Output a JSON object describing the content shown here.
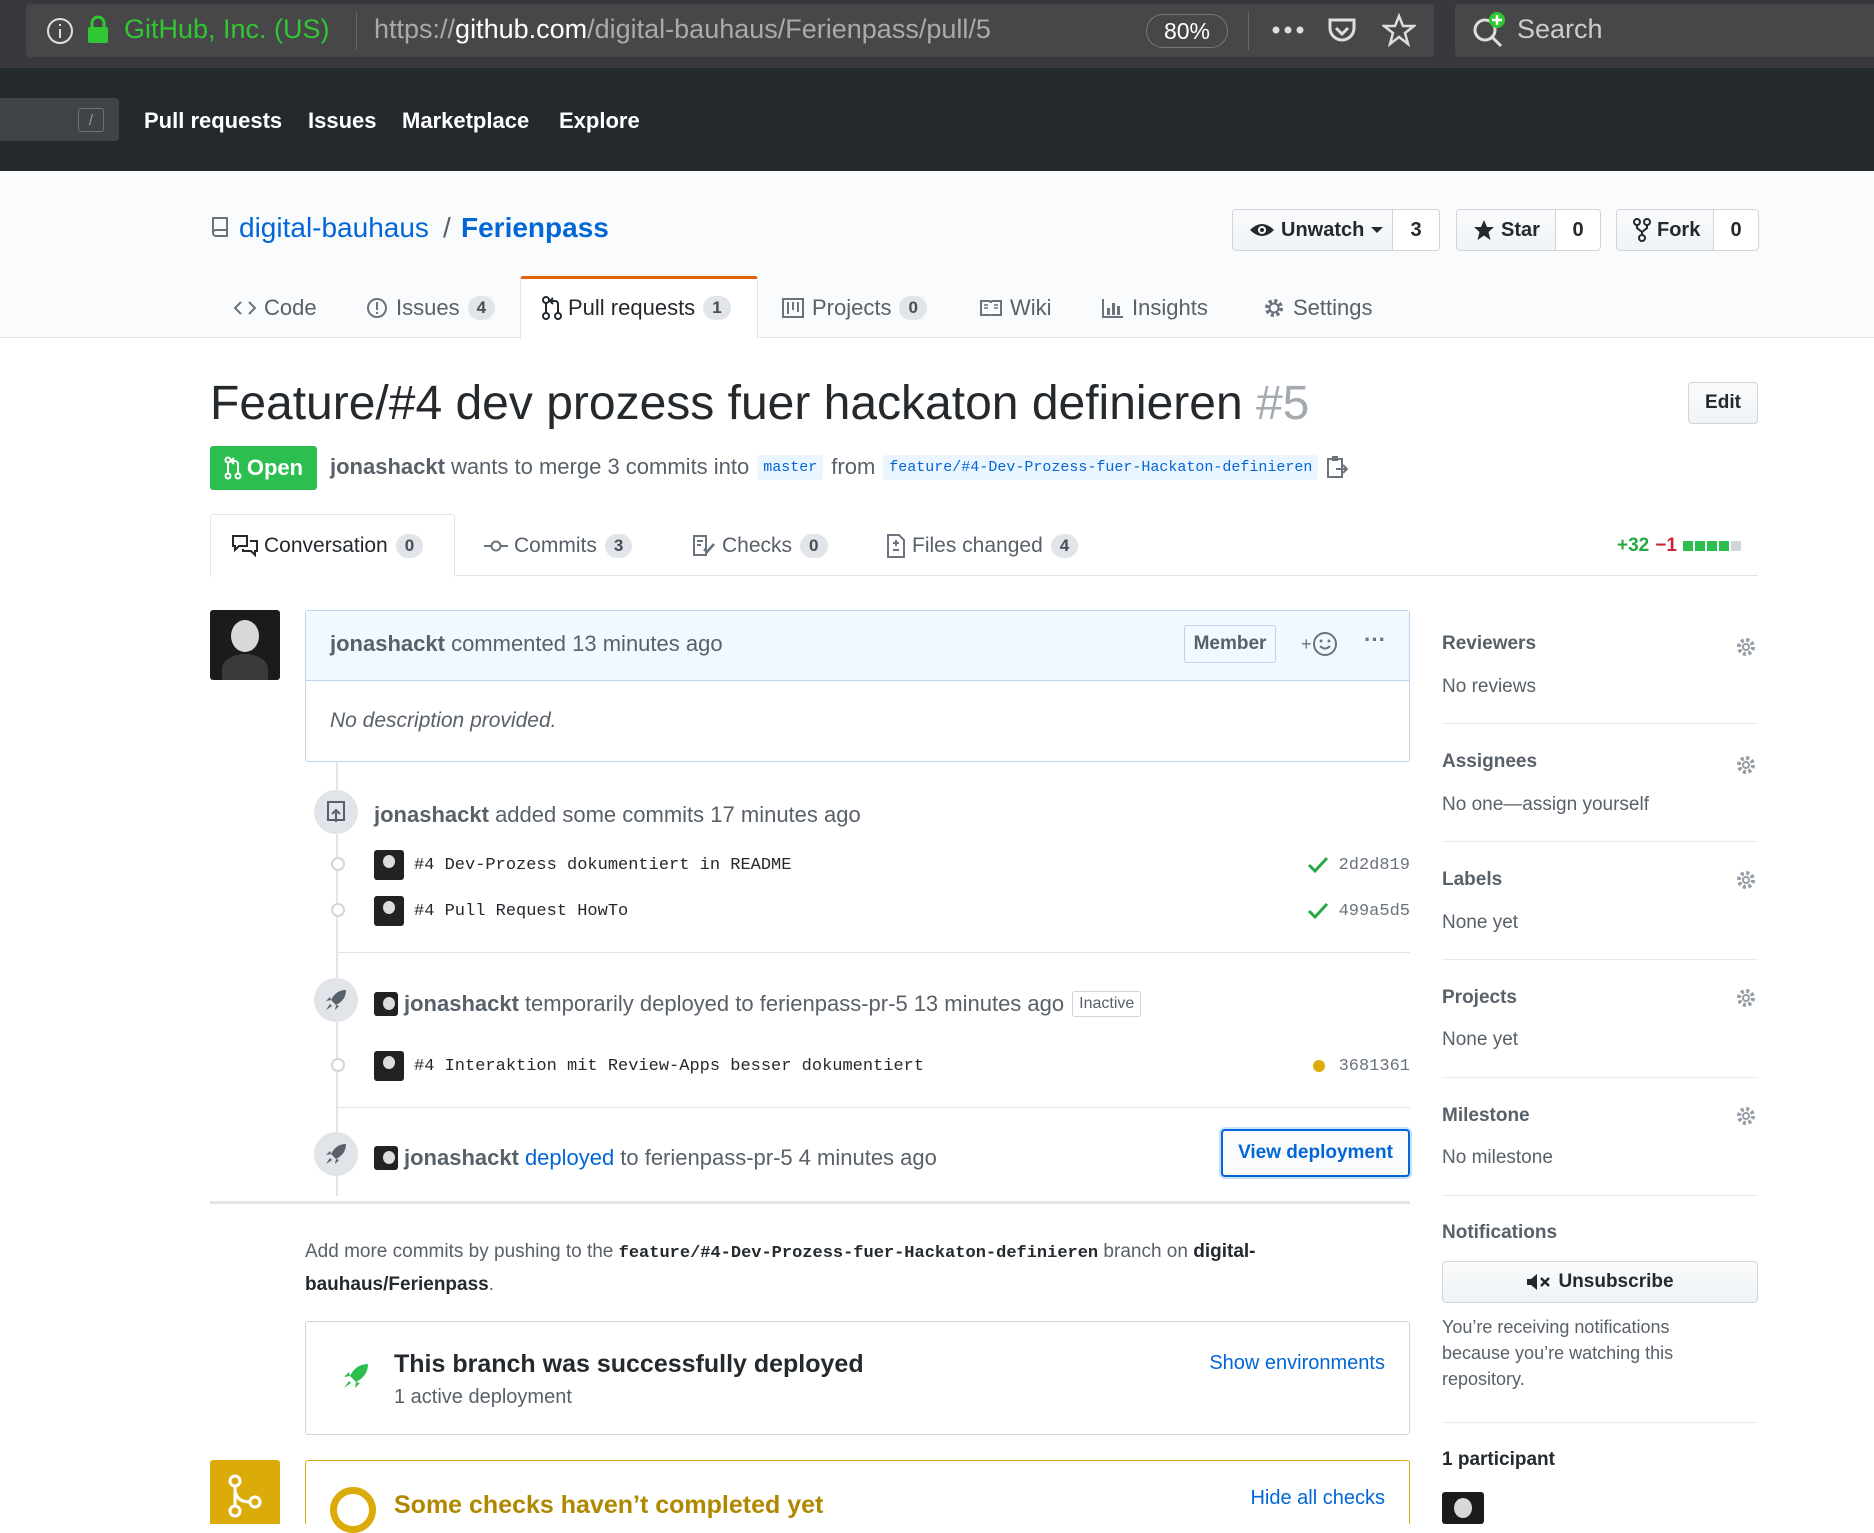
{
  "browser": {
    "identity": "GitHub, Inc. (US)",
    "url_prefix": "https://",
    "url_domain": "github.com",
    "url_path": "/digital-bauhaus/Ferienpass/pull/5",
    "zoom": "80%",
    "search_placeholder": "Search"
  },
  "header": {
    "slash": "/",
    "nav": [
      "Pull requests",
      "Issues",
      "Marketplace",
      "Explore"
    ]
  },
  "repo": {
    "owner": "digital-bauhaus",
    "sep": "/",
    "name": "Ferienpass",
    "unwatch_label": "Unwatch",
    "watch_count": "3",
    "star_label": "Star",
    "star_count": "0",
    "fork_label": "Fork",
    "fork_count": "0",
    "tabs": [
      {
        "label": "Code",
        "count": ""
      },
      {
        "label": "Issues",
        "count": "4"
      },
      {
        "label": "Pull requests",
        "count": "1"
      },
      {
        "label": "Projects",
        "count": "0"
      },
      {
        "label": "Wiki",
        "count": ""
      },
      {
        "label": "Insights",
        "count": ""
      },
      {
        "label": "Settings",
        "count": ""
      }
    ]
  },
  "pr": {
    "title": "Feature/#4 dev prozess fuer hackaton definieren",
    "number": "#5",
    "edit_label": "Edit",
    "state": "Open",
    "author": "jonashackt",
    "merge_text": "wants to merge 3 commits into",
    "base": "master",
    "from_text": "from",
    "head": "feature/#4-Dev-Prozess-fuer-Hackaton-definieren",
    "tabs": [
      {
        "label": "Conversation",
        "count": "0"
      },
      {
        "label": "Commits",
        "count": "3"
      },
      {
        "label": "Checks",
        "count": "0"
      },
      {
        "label": "Files changed",
        "count": "4"
      }
    ],
    "additions": "+32",
    "deletions": "−1"
  },
  "comment": {
    "author": "jonashackt",
    "action": "commented",
    "time": "13 minutes ago",
    "role": "Member",
    "reaction": "+",
    "more": "···",
    "body": "No description provided."
  },
  "timeline": {
    "commits_event": {
      "author": "jonashackt",
      "text": "added some commits",
      "time": "17 minutes ago"
    },
    "commits": [
      {
        "message": "#4 Dev-Prozess dokumentiert in README",
        "sha": "2d2d819",
        "status": "success"
      },
      {
        "message": "#4 Pull Request HowTo",
        "sha": "499a5d5",
        "status": "success"
      }
    ],
    "deploy1": {
      "author": "jonashackt",
      "text": "temporarily deployed to ferienpass-pr-5",
      "time": "13 minutes ago",
      "state": "Inactive"
    },
    "commit3": {
      "message": "#4 Interaktion mit Review-Apps besser dokumentiert",
      "sha": "3681361",
      "status": "pending"
    },
    "deploy2": {
      "author": "jonashackt",
      "link": "deployed",
      "text": "to ferienpass-pr-5",
      "time": "4 minutes ago",
      "button": "View deployment"
    }
  },
  "merge_info": {
    "pre": "Add more commits by pushing to the",
    "branch": "feature/#4-Dev-Prozess-fuer-Hackaton-definieren",
    "mid": "branch on",
    "repo_line1": "digital-",
    "repo_line2": "bauhaus/Ferienpass",
    "end": "."
  },
  "deploy_box": {
    "title": "This branch was successfully deployed",
    "subtitle": "1 active deployment",
    "link": "Show environments"
  },
  "checks_box": {
    "title": "Some checks haven’t completed yet",
    "link": "Hide all checks"
  },
  "sidebar": {
    "reviewers": {
      "title": "Reviewers",
      "value": "No reviews"
    },
    "assignees": {
      "title": "Assignees",
      "value": "No one—assign yourself"
    },
    "labels": {
      "title": "Labels",
      "value": "None yet"
    },
    "projects": {
      "title": "Projects",
      "value": "None yet"
    },
    "milestone": {
      "title": "Milestone",
      "value": "No milestone"
    },
    "notifications": {
      "title": "Notifications",
      "button": "Unsubscribe",
      "text1": "You’re receiving notifications",
      "text2": "because you’re watching this",
      "text3": "repository."
    },
    "participants": {
      "title": "1 participant"
    }
  },
  "colors": {
    "green": "#2cbe4e",
    "blue": "#0366d6",
    "yellow": "#dbab09",
    "dark": "#24292e"
  }
}
